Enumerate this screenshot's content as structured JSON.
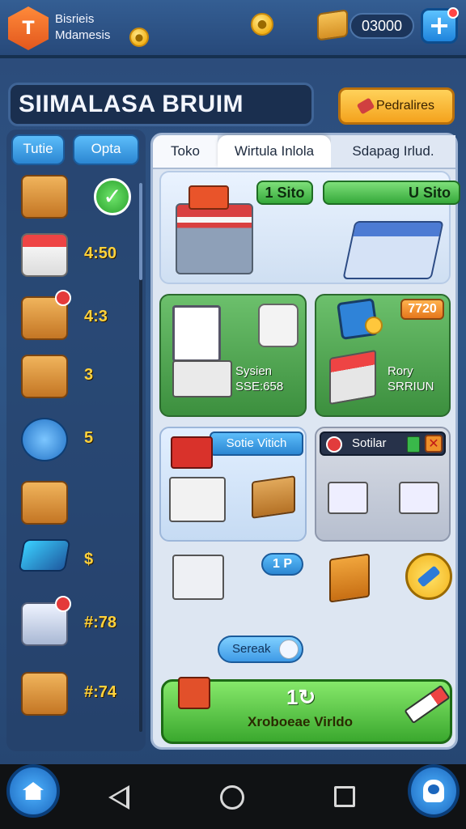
{
  "header": {
    "brand_line1": "Bisrieis",
    "brand_line2": "Mdamesis",
    "currency_amount": "03000",
    "plus_label": "+"
  },
  "title_row": {
    "title": "SIIMALASA BRUIM",
    "profile_button": "Pedralires"
  },
  "sidebar": {
    "tab_left": "Tutie",
    "tab_right": "Opta",
    "items": [
      {
        "icon": "wallet-icon",
        "value": "",
        "checked": true
      },
      {
        "icon": "market-stall-icon",
        "value": "4:50"
      },
      {
        "icon": "crate-icon",
        "value": "4:3"
      },
      {
        "icon": "box-icon",
        "value": "3"
      },
      {
        "icon": "phone-icon",
        "value": "5"
      },
      {
        "icon": "register-icon",
        "value": ""
      },
      {
        "icon": "tablet-icon",
        "value": "$"
      },
      {
        "icon": "vending-icon",
        "value": "#:78"
      },
      {
        "icon": "package-icon",
        "value": "#:74"
      }
    ]
  },
  "main": {
    "tabs": [
      "Toko",
      "Wirtula Inlola",
      "Sdapag Irlud."
    ],
    "active_tab": 1,
    "cards": {
      "card1": {
        "pill_left": "1 Sito",
        "pill_right": "U Sito"
      },
      "card2": {
        "label_line1": "Sysien",
        "label_line2": "SSE:658"
      },
      "card3": {
        "badge": "7720",
        "label_line1": "Rory",
        "label_line2": "SRRIUN"
      },
      "card4": {
        "header": "Sotie Vitich"
      },
      "card5": {
        "header": "Sotilar"
      }
    },
    "pill_1p": "1 P",
    "search_label": "Sereak",
    "cta": {
      "title": "1↻",
      "subtitle": "Xroboeae Virldo"
    }
  },
  "nav": {
    "home": "home",
    "profile": "profile"
  }
}
